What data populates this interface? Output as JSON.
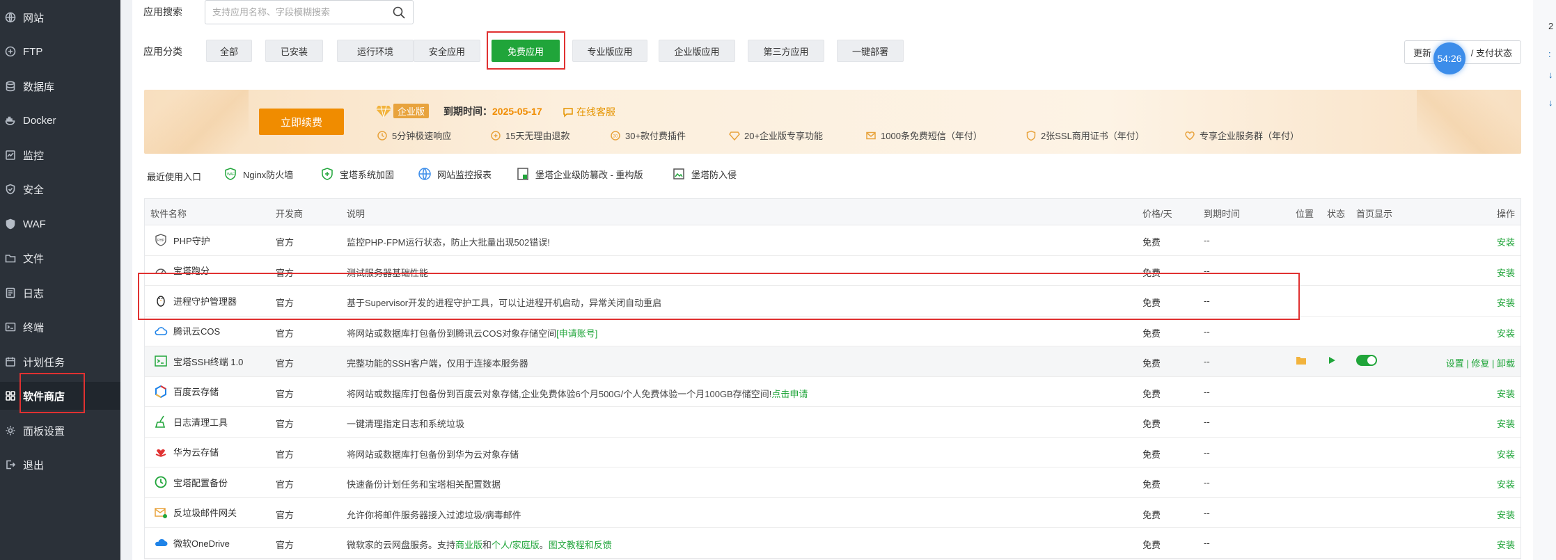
{
  "sidebar": {
    "items": [
      {
        "label": "网站",
        "icon": "globe-icon"
      },
      {
        "label": "FTP",
        "icon": "ftp-icon"
      },
      {
        "label": "数据库",
        "icon": "database-icon"
      },
      {
        "label": "Docker",
        "icon": "docker-icon"
      },
      {
        "label": "监控",
        "icon": "monitor-icon"
      },
      {
        "label": "安全",
        "icon": "shield-icon"
      },
      {
        "label": "WAF",
        "icon": "waf-shield-icon"
      },
      {
        "label": "文件",
        "icon": "folder-icon"
      },
      {
        "label": "日志",
        "icon": "log-icon"
      },
      {
        "label": "终端",
        "icon": "terminal-icon"
      },
      {
        "label": "计划任务",
        "icon": "calendar-icon"
      },
      {
        "label": "软件商店",
        "icon": "grid-icon",
        "active": true
      },
      {
        "label": "面板设置",
        "icon": "gear-icon"
      },
      {
        "label": "退出",
        "icon": "logout-icon"
      }
    ]
  },
  "search": {
    "label": "应用搜索",
    "placeholder": "支持应用名称、字段模糊搜索"
  },
  "category": {
    "label": "应用分类",
    "tabs": [
      "全部",
      "已安装",
      "运行环境",
      "安全应用",
      "免费应用",
      "专业版应用",
      "企业版应用",
      "第三方应用",
      "一键部署"
    ],
    "active": "免费应用"
  },
  "update_button": {
    "left": "更新",
    "right": "/ 支付状态"
  },
  "timer": "54:26",
  "banner": {
    "renew": "立即续费",
    "edition": "企业版",
    "expire_label": "到期时间：",
    "expire_date": "2025-05-17",
    "service": "在线客服",
    "features": [
      "5分钟极速响应",
      "15天无理由退款",
      "30+款付费插件",
      "20+企业版专享功能",
      "1000条免费短信（年付）",
      "2张SSL商用证书（年付）",
      "专享企业服务群（年付）"
    ]
  },
  "recent": {
    "label": "最近使用入口",
    "items": [
      "Nginx防火墙",
      "宝塔系统加固",
      "网站监控报表",
      "堡塔企业级防篡改 - 重构版",
      "堡塔防入侵"
    ]
  },
  "table": {
    "headers": {
      "name": "软件名称",
      "dev": "开发商",
      "desc": "说明",
      "price": "价格/天",
      "expire": "到期时间",
      "pos": "位置",
      "status": "状态",
      "home": "首页显示",
      "op": "操作"
    },
    "rows": [
      {
        "name": "PHP守护",
        "dev": "官方",
        "desc": "监控PHP-FPM运行状态，防止大批量出现502错误!",
        "desc_link": "",
        "price": "免费",
        "expire": "--",
        "op": "安装"
      },
      {
        "name": "宝塔跑分",
        "dev": "官方",
        "desc": "测试服务器基础性能",
        "desc_link": "",
        "price": "免费",
        "expire": "--",
        "op": "安装"
      },
      {
        "name": "进程守护管理器",
        "dev": "官方",
        "desc": "基于Supervisor开发的进程守护工具，可以让进程开机启动，异常关闭自动重启",
        "desc_link": "",
        "price": "免费",
        "expire": "--",
        "op": "安装"
      },
      {
        "name": "腾讯云COS",
        "dev": "官方",
        "desc": "将网站或数据库打包备份到腾讯云COS对象存储空间",
        "desc_link": "[申请账号]",
        "price": "免费",
        "expire": "--",
        "op": "安装"
      },
      {
        "name": "宝塔SSH终端 1.0",
        "dev": "官方",
        "desc": "完整功能的SSH客户端，仅用于连接本服务器",
        "desc_link": "",
        "price": "免费",
        "expire": "--",
        "op": "设置 | 修复 | 卸载"
      },
      {
        "name": "百度云存储",
        "dev": "官方",
        "desc": "将网站或数据库打包备份到百度云对象存储,企业免费体验6个月500G/个人免费体验一个月100GB存储空间!",
        "desc_link": "点击申请",
        "price": "免费",
        "expire": "--",
        "op": "安装"
      },
      {
        "name": "日志清理工具",
        "dev": "官方",
        "desc": "一键清理指定日志和系统垃圾",
        "desc_link": "",
        "price": "免费",
        "expire": "--",
        "op": "安装"
      },
      {
        "name": "华为云存储",
        "dev": "官方",
        "desc": "将网站或数据库打包备份到华为云对象存储",
        "desc_link": "",
        "price": "免费",
        "expire": "--",
        "op": "安装"
      },
      {
        "name": "宝塔配置备份",
        "dev": "官方",
        "desc": "快速备份计划任务和宝塔相关配置数据",
        "desc_link": "",
        "price": "免费",
        "expire": "--",
        "op": "安装"
      },
      {
        "name": "反垃圾邮件网关",
        "dev": "官方",
        "desc": "允许你将邮件服务器接入过滤垃圾/病毒邮件",
        "desc_link": "",
        "price": "免费",
        "expire": "--",
        "op": "安装"
      },
      {
        "name": "微软OneDrive",
        "dev": "官方",
        "desc": "微软家的云网盘服务。支持",
        "desc_link": "商业版",
        "desc_mid": "和",
        "desc_link2": "个人/家庭版",
        "desc_end": "。",
        "desc_link3": "图文教程和反馈",
        "price": "免费",
        "expire": "--",
        "op": "安装"
      }
    ]
  },
  "colors": {
    "accent": "#20a53a",
    "sidebar": "#2b3139",
    "highlight": "#e03131",
    "orange": "#f08c00"
  }
}
